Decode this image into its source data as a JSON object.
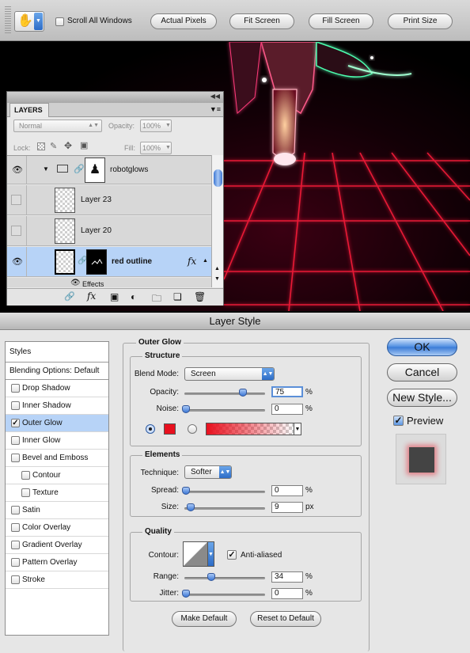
{
  "toolbar": {
    "tool_icon": "hand-icon",
    "scroll_all_windows": "Scroll All Windows",
    "scroll_all_checked": false,
    "buttons": [
      "Actual Pixels",
      "Fit Screen",
      "Fill Screen",
      "Print Size"
    ]
  },
  "layers_panel": {
    "tab": "LAYERS",
    "blend_mode": "Normal",
    "opacity_label": "Opacity:",
    "opacity_value": "100%",
    "lock_label": "Lock:",
    "fill_label": "Fill:",
    "fill_value": "100%",
    "layers": [
      {
        "name": "robotglows",
        "visible": true,
        "type": "group"
      },
      {
        "name": "Layer 23",
        "visible": false,
        "type": "layer"
      },
      {
        "name": "Layer 20",
        "visible": false,
        "type": "layer"
      },
      {
        "name": "red outline",
        "visible": true,
        "type": "layer",
        "selected": true,
        "fx": "fx"
      }
    ],
    "effects_label": "Effects"
  },
  "dialog": {
    "title": "Layer Style",
    "styles_header": "Styles",
    "blending_options": "Blending Options: Default",
    "styles": [
      {
        "label": "Drop Shadow",
        "checked": false,
        "indent": false
      },
      {
        "label": "Inner Shadow",
        "checked": false,
        "indent": false
      },
      {
        "label": "Outer Glow",
        "checked": true,
        "indent": false,
        "selected": true
      },
      {
        "label": "Inner Glow",
        "checked": false,
        "indent": false
      },
      {
        "label": "Bevel and Emboss",
        "checked": false,
        "indent": false
      },
      {
        "label": "Contour",
        "checked": false,
        "indent": true
      },
      {
        "label": "Texture",
        "checked": false,
        "indent": true
      },
      {
        "label": "Satin",
        "checked": false,
        "indent": false
      },
      {
        "label": "Color Overlay",
        "checked": false,
        "indent": false
      },
      {
        "label": "Gradient Overlay",
        "checked": false,
        "indent": false
      },
      {
        "label": "Pattern Overlay",
        "checked": false,
        "indent": false
      },
      {
        "label": "Stroke",
        "checked": false,
        "indent": false
      }
    ],
    "section_title": "Outer Glow",
    "structure": {
      "label": "Structure",
      "blend_mode_label": "Blend Mode:",
      "blend_mode": "Screen",
      "opacity_label": "Opacity:",
      "opacity": "75",
      "opacity_level": 0.75,
      "opacity_unit": "%",
      "noise_label": "Noise:",
      "noise": "0",
      "noise_unit": "%",
      "glow_color": "#e8101e"
    },
    "elements": {
      "label": "Elements",
      "technique_label": "Technique:",
      "technique": "Softer",
      "spread_label": "Spread:",
      "spread": "0",
      "spread_unit": "%",
      "size_label": "Size:",
      "size": "9",
      "size_unit": "px"
    },
    "quality": {
      "label": "Quality",
      "contour_label": "Contour:",
      "anti_aliased_label": "Anti-aliased",
      "anti_aliased": true,
      "range_label": "Range:",
      "range": "34",
      "range_unit": "%",
      "jitter_label": "Jitter:",
      "jitter": "0",
      "jitter_unit": "%"
    },
    "make_default": "Make Default",
    "reset_default": "Reset to Default",
    "ok": "OK",
    "cancel": "Cancel",
    "new_style": "New Style...",
    "preview_label": "Preview",
    "preview_checked": true
  }
}
